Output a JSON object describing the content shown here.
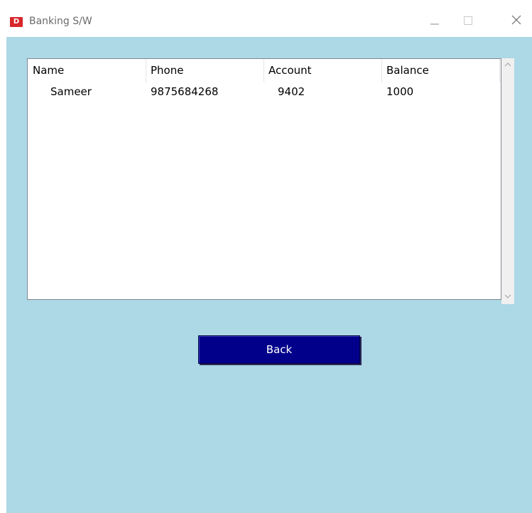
{
  "window": {
    "title": "Banking S/W",
    "app_icon_glyph": "D",
    "app_icon_color": "#d8262b",
    "client_bg": "#add8e6"
  },
  "table": {
    "columns": [
      "Name",
      "Phone",
      "Account",
      "Balance"
    ],
    "rows": [
      [
        "Sameer",
        "9875684268",
        "9402",
        "1000"
      ]
    ]
  },
  "buttons": {
    "back_label": "Back",
    "back_color": "#00008b"
  },
  "icons": {
    "minimize": "minimize-icon",
    "maximize": "maximize-icon",
    "close": "close-icon",
    "scroll_up": "chevron-up-icon",
    "scroll_down": "chevron-down-icon"
  }
}
